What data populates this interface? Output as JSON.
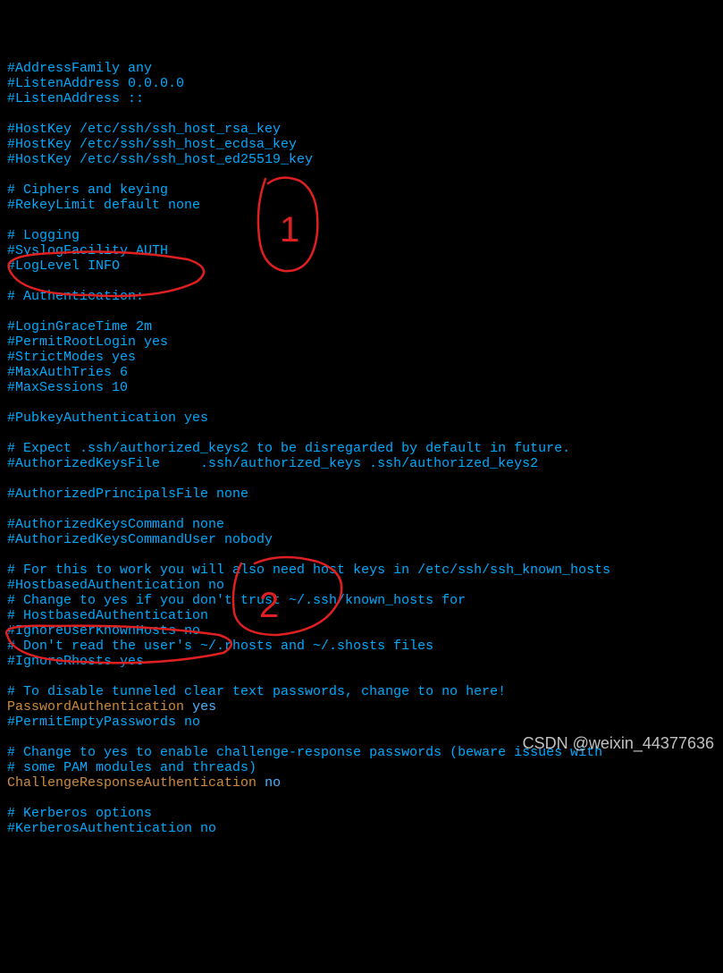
{
  "lines": [
    "#AddressFamily any",
    "#ListenAddress 0.0.0.0",
    "#ListenAddress ::",
    "",
    "#HostKey /etc/ssh/ssh_host_rsa_key",
    "#HostKey /etc/ssh/ssh_host_ecdsa_key",
    "#HostKey /etc/ssh/ssh_host_ed25519_key",
    "",
    "# Ciphers and keying",
    "#RekeyLimit default none",
    "",
    "# Logging",
    "#SyslogFacility AUTH",
    "#LogLevel INFO",
    "",
    "# Authentication:",
    "",
    "#LoginGraceTime 2m",
    "#PermitRootLogin yes",
    "#StrictModes yes",
    "#MaxAuthTries 6",
    "#MaxSessions 10",
    "",
    "#PubkeyAuthentication yes",
    "",
    "# Expect .ssh/authorized_keys2 to be disregarded by default in future.",
    "#AuthorizedKeysFile     .ssh/authorized_keys .ssh/authorized_keys2",
    "",
    "#AuthorizedPrincipalsFile none",
    "",
    "#AuthorizedKeysCommand none",
    "#AuthorizedKeysCommandUser nobody",
    "",
    "# For this to work you will also need host keys in /etc/ssh/ssh_known_hosts",
    "#HostbasedAuthentication no",
    "# Change to yes if you don't trust ~/.ssh/known_hosts for",
    "# HostbasedAuthentication",
    "#IgnoreUserKnownHosts no",
    "# Don't read the user's ~/.rhosts and ~/.shosts files",
    "#IgnoreRhosts yes",
    "",
    "# To disable tunneled clear text passwords, change to no here!"
  ],
  "passwordAuth": {
    "key": "PasswordAuthentication",
    "val": "yes"
  },
  "lines2": [
    "#PermitEmptyPasswords no",
    "",
    "# Change to yes to enable challenge-response passwords (beware issues with",
    "# some PAM modules and threads)"
  ],
  "cra": {
    "key": "ChallengeResponseAuthentication",
    "val": "no"
  },
  "lines3": [
    "",
    "# Kerberos options",
    "#KerberosAuthentication no"
  ],
  "watermark": "CSDN @weixin_44377636",
  "annotations": {
    "label1": "1",
    "label2": "2"
  }
}
